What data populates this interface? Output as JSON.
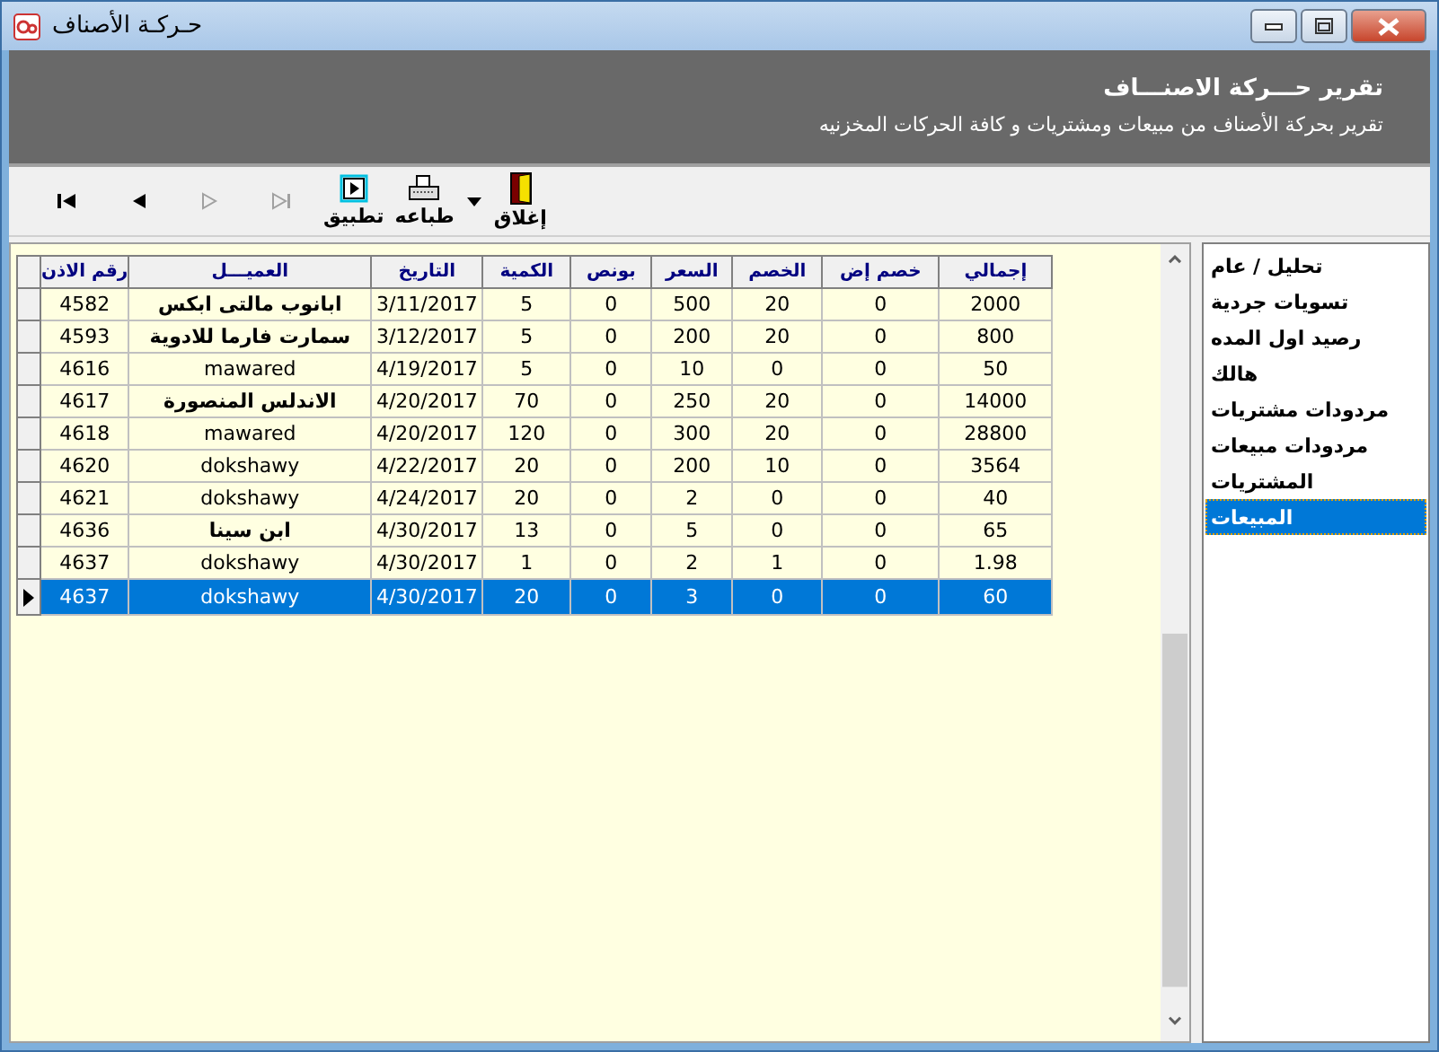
{
  "window": {
    "title": "حـركـة الأصناف"
  },
  "header": {
    "title": "تقرير حـــركة الاصنـــاف",
    "subtitle": "تقرير بحركة الأصناف من مبيعات ومشتريات و كافة الحركات المخزنيه"
  },
  "toolbar": [
    {
      "kind": "close",
      "label": "إغلاق",
      "disabled": false
    },
    {
      "kind": "dropdown",
      "disabled": false
    },
    {
      "kind": "print",
      "label": "طباعه",
      "disabled": false
    },
    {
      "kind": "apply",
      "label": "تطبيق",
      "disabled": false
    },
    {
      "kind": "last",
      "disabled": true
    },
    {
      "kind": "next",
      "disabled": true
    },
    {
      "kind": "prev",
      "disabled": false
    },
    {
      "kind": "first",
      "disabled": false
    }
  ],
  "table": {
    "columns": [
      "إجمالي",
      "خصم إض",
      "الخصم",
      "السعر",
      "بونص",
      "الكمية",
      "التاريخ",
      "العميـــل",
      "رقم الاذن"
    ],
    "rows": [
      {
        "selected": false,
        "cells": [
          "2000",
          "0",
          "20",
          "500",
          "0",
          "5",
          "3/11/2017",
          "ابانوب مالتى ابكس",
          "4582"
        ]
      },
      {
        "selected": false,
        "cells": [
          "800",
          "0",
          "20",
          "200",
          "0",
          "5",
          "3/12/2017",
          "سمارت فارما للادوية",
          "4593"
        ]
      },
      {
        "selected": false,
        "cells": [
          "50",
          "0",
          "0",
          "10",
          "0",
          "5",
          "4/19/2017",
          "mawared",
          "4616"
        ]
      },
      {
        "selected": false,
        "cells": [
          "14000",
          "0",
          "20",
          "250",
          "0",
          "70",
          "4/20/2017",
          "الاندلس المنصورة",
          "4617"
        ]
      },
      {
        "selected": false,
        "cells": [
          "28800",
          "0",
          "20",
          "300",
          "0",
          "120",
          "4/20/2017",
          "mawared",
          "4618"
        ]
      },
      {
        "selected": false,
        "cells": [
          "3564",
          "0",
          "10",
          "200",
          "0",
          "20",
          "4/22/2017",
          "dokshawy",
          "4620"
        ]
      },
      {
        "selected": false,
        "cells": [
          "40",
          "0",
          "0",
          "2",
          "0",
          "20",
          "4/24/2017",
          "dokshawy",
          "4621"
        ]
      },
      {
        "selected": false,
        "cells": [
          "65",
          "0",
          "0",
          "5",
          "0",
          "13",
          "4/30/2017",
          "ابن سينا",
          "4636"
        ]
      },
      {
        "selected": false,
        "cells": [
          "1.98",
          "0",
          "1",
          "2",
          "0",
          "1",
          "4/30/2017",
          "dokshawy",
          "4637"
        ]
      },
      {
        "selected": true,
        "cells": [
          "60",
          "0",
          "0",
          "3",
          "0",
          "20",
          "4/30/2017",
          "dokshawy",
          "4637"
        ]
      }
    ]
  },
  "sidebar": {
    "items": [
      {
        "label": "تحليل / عام",
        "selected": false
      },
      {
        "label": "تسويات جردية",
        "selected": false
      },
      {
        "label": "رصيد اول المده",
        "selected": false
      },
      {
        "label": "هالك",
        "selected": false
      },
      {
        "label": "مردودات مشتريات",
        "selected": false
      },
      {
        "label": "مردودات مبيعات",
        "selected": false
      },
      {
        "label": "المشتريات",
        "selected": false
      },
      {
        "label": "المبيعات",
        "selected": true
      }
    ]
  }
}
